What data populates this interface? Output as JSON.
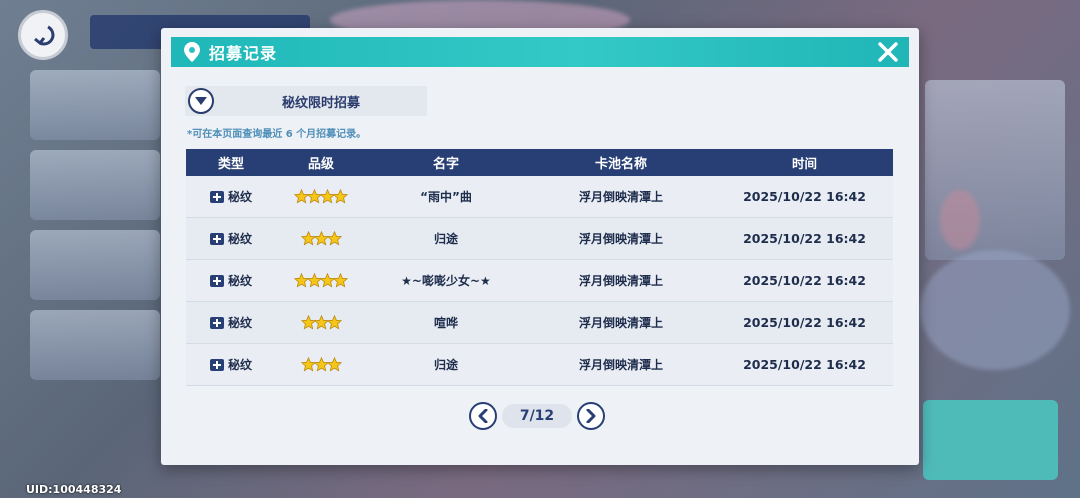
{
  "dialog": {
    "title": "招募记录",
    "pool_selector": "秘纹限时招募",
    "notice": "*可在本页面查询最近 6 个月招募记录。"
  },
  "table": {
    "headers": [
      "类型",
      "品级",
      "名字",
      "卡池名称",
      "时间"
    ],
    "rows": [
      {
        "type": "秘纹",
        "stars": 4,
        "name": "“雨中”曲",
        "pool": "浮月倒映清潭上",
        "time": "2025/10/22 16:42"
      },
      {
        "type": "秘纹",
        "stars": 3,
        "name": "归途",
        "pool": "浮月倒映清潭上",
        "time": "2025/10/22 16:42"
      },
      {
        "type": "秘纹",
        "stars": 4,
        "name": "★~嘭嘭少女~★",
        "pool": "浮月倒映清潭上",
        "time": "2025/10/22 16:42"
      },
      {
        "type": "秘纹",
        "stars": 3,
        "name": "喧哗",
        "pool": "浮月倒映清潭上",
        "time": "2025/10/22 16:42"
      },
      {
        "type": "秘纹",
        "stars": 3,
        "name": "归途",
        "pool": "浮月倒映清潭上",
        "time": "2025/10/22 16:42"
      }
    ]
  },
  "pager": {
    "label": "7/12"
  },
  "footer": {
    "uid": "UID:100448324"
  },
  "icons": {
    "title": "location-pin-icon",
    "close": "close-icon",
    "dropdown": "chevron-down-icon",
    "type": "card-icon",
    "star": "star-icon",
    "prev": "chevron-left-icon",
    "next": "chevron-right-icon",
    "back": "back-arrow-icon"
  },
  "colors": {
    "titlebar": "#2ec0c0",
    "header": "#283f75",
    "star": "#f5c518",
    "text": "#1f2d4d"
  }
}
